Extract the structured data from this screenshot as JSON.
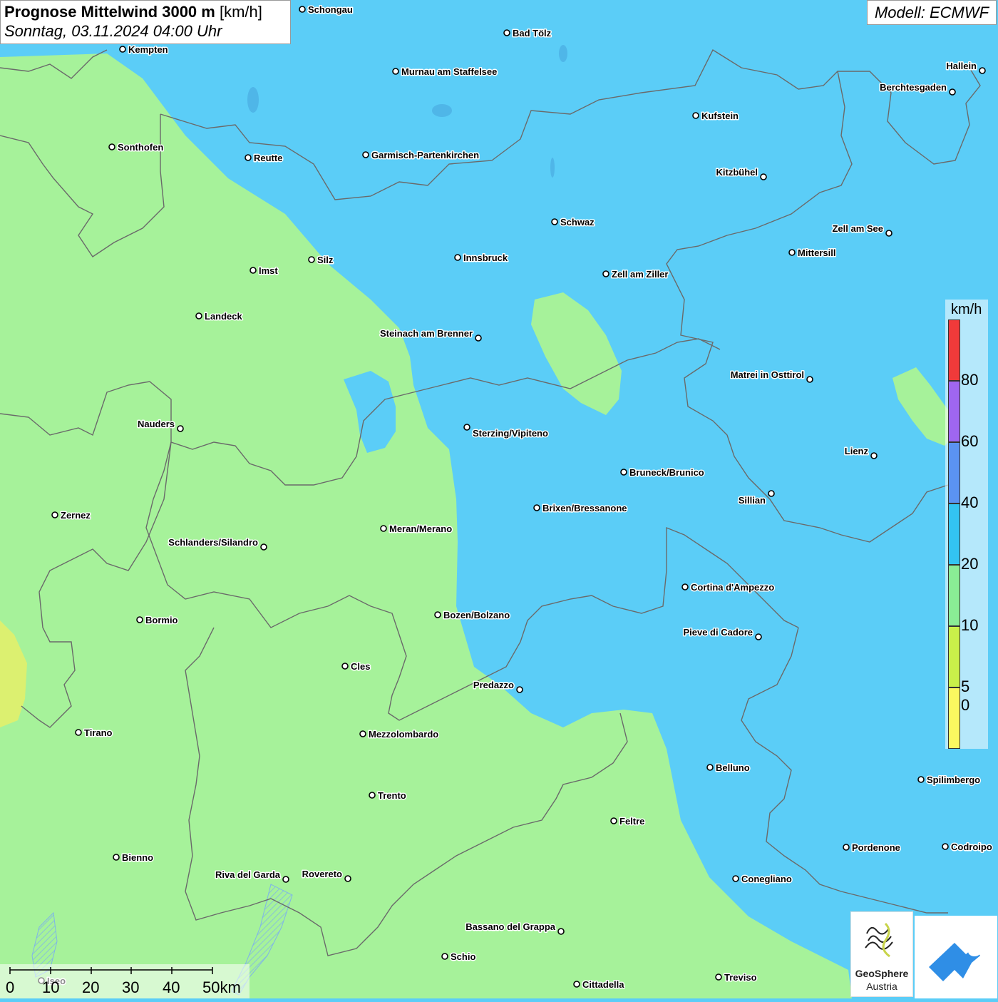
{
  "header": {
    "title_bold": "Prognose Mittelwind 3000 m",
    "title_unit": "[km/h]",
    "subtitle": "Sonntag, 03.11.2024 04:00 Uhr",
    "model": "Modell: ECMWF"
  },
  "legend": {
    "unit": "km/h",
    "labels": [
      "80",
      "60",
      "40",
      "20",
      "10",
      "5",
      "0"
    ],
    "colors": [
      "#f03a3a",
      "#9f66f0",
      "#5b93f2",
      "#33c4f2",
      "#8aec95",
      "#c9f04a",
      "#fbf860"
    ]
  },
  "scale_bar": {
    "labels": [
      "0",
      "10",
      "20",
      "30",
      "40",
      "50km"
    ]
  },
  "logos": {
    "geosphere_line1": "GeoSphere",
    "geosphere_line2": "Austria"
  },
  "colors": {
    "wind_10_20": "#a6f29a",
    "wind_20_40": "#5bcdf7",
    "wind_5_10": "#dcf070",
    "border": "#6a6a6a"
  },
  "cities": [
    {
      "name": "Schongau"
    },
    {
      "name": "Bad Tölz"
    },
    {
      "name": "Kempten"
    },
    {
      "name": "Murnau am Staffelsee"
    },
    {
      "name": "Hallein"
    },
    {
      "name": "Berchtesgaden"
    },
    {
      "name": "Kufstein"
    },
    {
      "name": "Sonthofen"
    },
    {
      "name": "Reutte"
    },
    {
      "name": "Garmisch-Partenkirchen"
    },
    {
      "name": "Kitzbühel"
    },
    {
      "name": "Schwaz"
    },
    {
      "name": "Zell am See"
    },
    {
      "name": "Mittersill"
    },
    {
      "name": "Innsbruck"
    },
    {
      "name": "Silz"
    },
    {
      "name": "Imst"
    },
    {
      "name": "Zell am Ziller"
    },
    {
      "name": "Landeck"
    },
    {
      "name": "Steinach am Brenner"
    },
    {
      "name": "Matrei in Osttirol"
    },
    {
      "name": "Nauders"
    },
    {
      "name": "Sterzing/Vipiteno"
    },
    {
      "name": "Lienz"
    },
    {
      "name": "Bruneck/Brunico"
    },
    {
      "name": "Sillian"
    },
    {
      "name": "Zernez"
    },
    {
      "name": "Brixen/Bressanone"
    },
    {
      "name": "Meran/Merano"
    },
    {
      "name": "Schlanders/Silandro"
    },
    {
      "name": "Cortina d'Ampezzo"
    },
    {
      "name": "Bozen/Bolzano"
    },
    {
      "name": "Bormio"
    },
    {
      "name": "Pieve di Cadore"
    },
    {
      "name": "Cles"
    },
    {
      "name": "Predazzo"
    },
    {
      "name": "Tirano"
    },
    {
      "name": "Mezzolombardo"
    },
    {
      "name": "Belluno"
    },
    {
      "name": "Spilimbergo"
    },
    {
      "name": "Trento"
    },
    {
      "name": "Feltre"
    },
    {
      "name": "Pordenone"
    },
    {
      "name": "Codroipo"
    },
    {
      "name": "Bienno"
    },
    {
      "name": "Riva del Garda"
    },
    {
      "name": "Rovereto"
    },
    {
      "name": "Conegliano"
    },
    {
      "name": "Bassano del Grappa"
    },
    {
      "name": "Schio"
    },
    {
      "name": "Treviso"
    },
    {
      "name": "Cittadella"
    },
    {
      "name": "Iseo"
    }
  ]
}
